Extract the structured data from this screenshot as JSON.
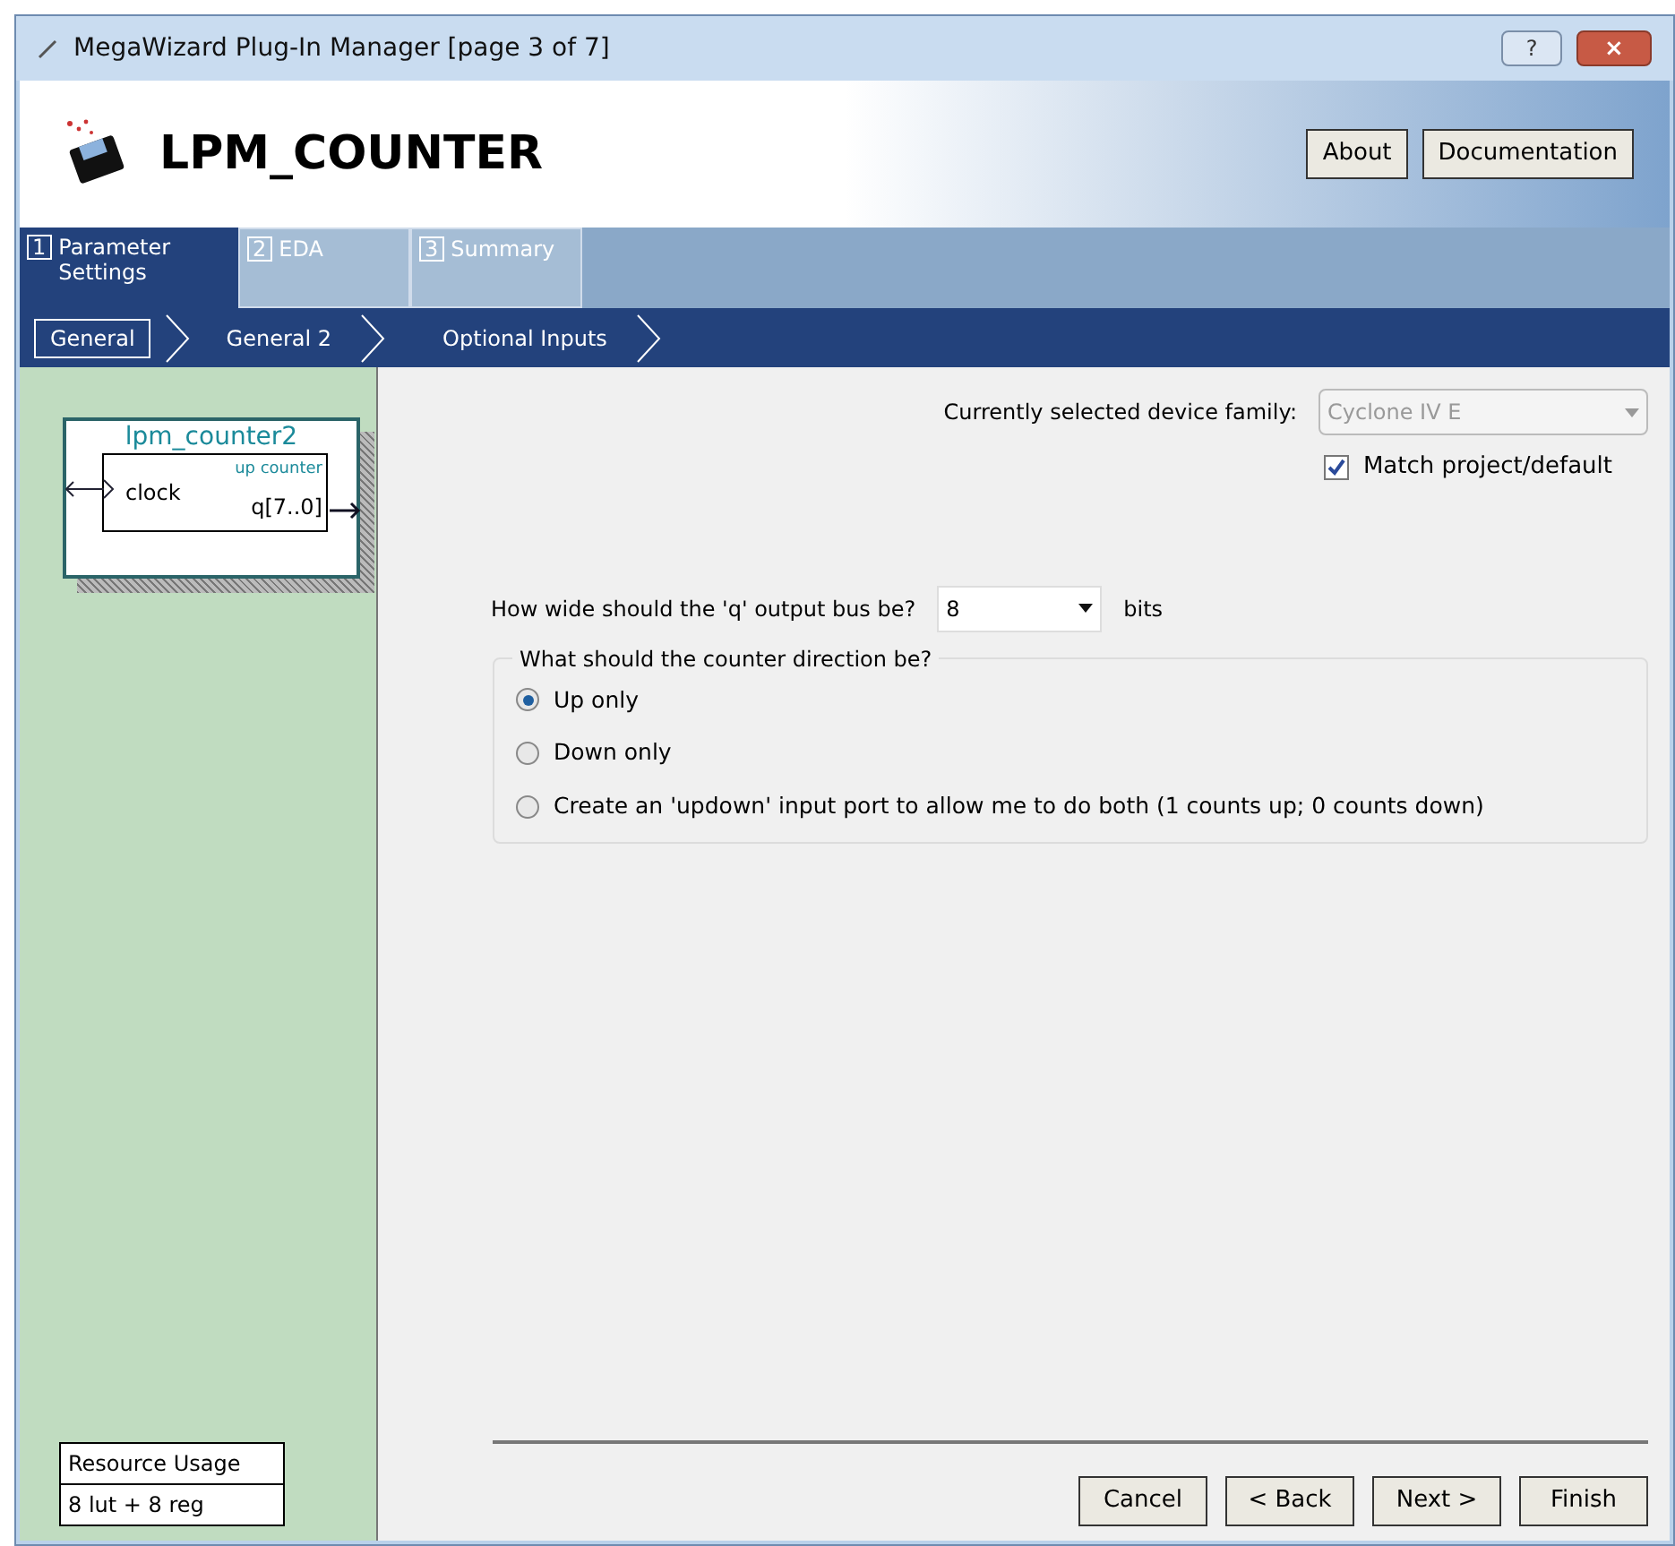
{
  "window": {
    "title": "MegaWizard Plug-In Manager [page 3 of 7]",
    "title_buttons": [
      "?",
      "×"
    ]
  },
  "header": {
    "title": "LPM_COUNTER",
    "buttons": [
      "About",
      "Documentation"
    ]
  },
  "tabs": [
    {
      "number": "1",
      "label": "Parameter Settings",
      "selected": true
    },
    {
      "number": "2",
      "label": "EDA",
      "selected": false
    },
    {
      "number": "3",
      "label": "Summary",
      "selected": false
    }
  ],
  "steps": [
    {
      "label": "General",
      "selected": true
    },
    {
      "label": "General 2",
      "selected": false
    },
    {
      "label": "Optional Inputs",
      "selected": false
    }
  ],
  "symbol": {
    "name": "lpm_counter2",
    "input": "clock",
    "kind_label": "up counter",
    "output": "q[7..0]"
  },
  "resource_usage": {
    "title": "Resource Usage",
    "value": "8 lut + 8 reg"
  },
  "device_family": {
    "label": "Currently selected device family:",
    "value": "Cyclone IV E",
    "disabled": true
  },
  "match_project": {
    "label": "Match project/default",
    "checked": true
  },
  "width": {
    "label": "How wide should the 'q' output bus be?",
    "value": "8",
    "unit": "bits"
  },
  "direction": {
    "title": "What should the counter direction be?",
    "options": [
      {
        "label": "Up only",
        "selected": true
      },
      {
        "label": "Down only",
        "selected": false
      },
      {
        "label": "Create an 'updown' input port to allow me to do both (1 counts up; 0 counts down)",
        "selected": false
      }
    ]
  },
  "footer_buttons": [
    "Cancel",
    "< Back",
    "Next >",
    "Finish"
  ]
}
